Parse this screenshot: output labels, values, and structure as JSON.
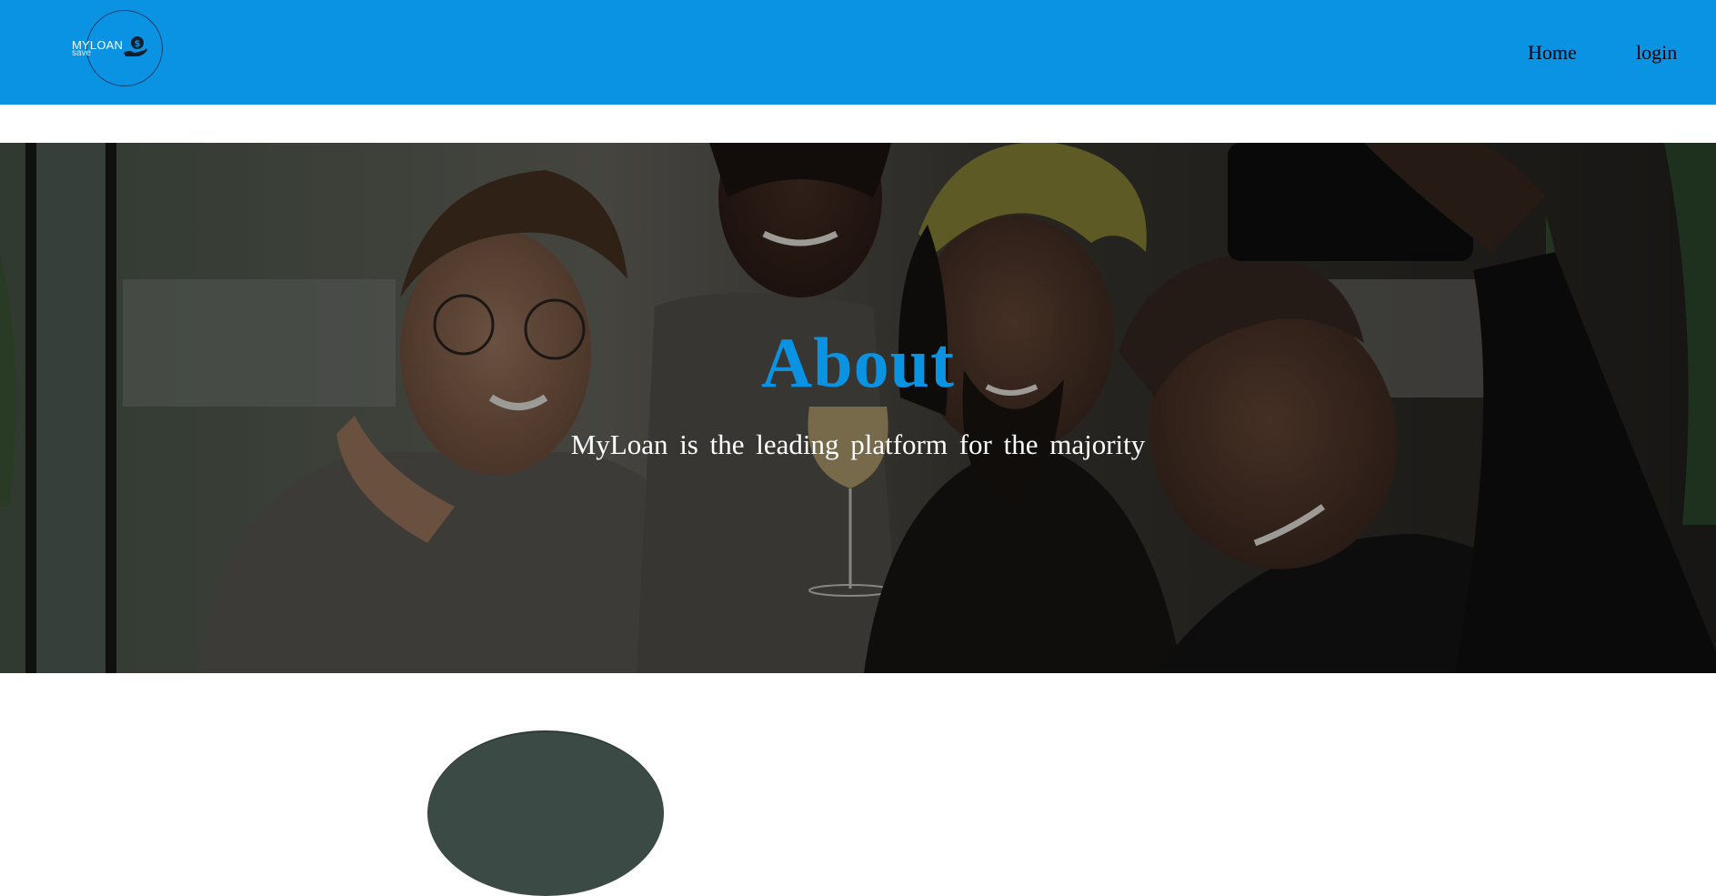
{
  "header": {
    "logo": {
      "title": "MYLOAN",
      "subtitle": "save",
      "icon": "hand-dollar-icon"
    },
    "nav": [
      {
        "label": "Home"
      },
      {
        "label": "login"
      }
    ],
    "background_color": "#0a93e3"
  },
  "hero": {
    "title": "About",
    "subtitle": "MyLoan is the leading platform for the majority",
    "title_color": "#0a93e3",
    "subtitle_color": "#ffffff"
  }
}
